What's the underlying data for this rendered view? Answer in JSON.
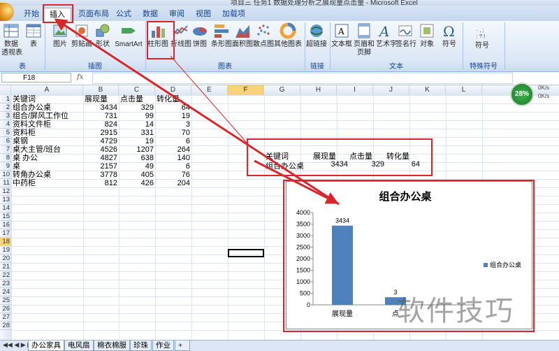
{
  "window": {
    "title": "项目三 任务1 数据处理分析之展现量点击量 - Microsoft Excel"
  },
  "tabs": [
    {
      "label": "开始"
    },
    {
      "label": "插入"
    },
    {
      "label": "页面布局"
    },
    {
      "label": "公式"
    },
    {
      "label": "数据"
    },
    {
      "label": "审阅"
    },
    {
      "label": "视图"
    },
    {
      "label": "加载项"
    }
  ],
  "ribbon": {
    "buttons": [
      {
        "label": "数据",
        "label2": "透视表",
        "icon": "pivot-table-icon"
      },
      {
        "label": "表",
        "icon": "table-icon"
      },
      {
        "label": "图片",
        "icon": "picture-icon"
      },
      {
        "label": "剪贴画",
        "icon": "clipart-icon"
      },
      {
        "label": "形状",
        "icon": "shapes-icon"
      },
      {
        "label": "SmartArt",
        "icon": "smartart-icon"
      },
      {
        "label": "柱形图",
        "icon": "column-chart-icon"
      },
      {
        "label": "折线图",
        "icon": "line-chart-icon"
      },
      {
        "label": "饼图",
        "icon": "pie-chart-icon"
      },
      {
        "label": "条形图",
        "icon": "bar-chart-icon"
      },
      {
        "label": "面积图",
        "icon": "area-chart-icon"
      },
      {
        "label": "散点图",
        "icon": "scatter-chart-icon"
      },
      {
        "label": "其他图表",
        "icon": "other-chart-icon"
      },
      {
        "label": "超链接",
        "icon": "hyperlink-icon"
      },
      {
        "label": "文本框",
        "icon": "textbox-icon"
      },
      {
        "label": "页眉和",
        "label2": "页脚",
        "icon": "header-footer-icon"
      },
      {
        "label": "艺术字",
        "icon": "wordart-icon"
      },
      {
        "label": "签名行",
        "icon": "signature-icon"
      },
      {
        "label": "对象",
        "icon": "object-icon"
      },
      {
        "label": "符号",
        "icon": "omega-icon"
      },
      {
        "label": "符号",
        "icon": "symbol-icon"
      }
    ],
    "groups": [
      "表",
      "插图",
      "图表",
      "链接",
      "文本",
      "特殊符号"
    ]
  },
  "formula_bar": {
    "name_box": "F18",
    "fx": "fx"
  },
  "columns": [
    "A",
    "B",
    "C",
    "D",
    "E",
    "F",
    "G",
    "H",
    "I",
    "J",
    "K",
    "L"
  ],
  "rows": [
    "1",
    "2",
    "3",
    "4",
    "5",
    "6",
    "7",
    "8",
    "9",
    "10",
    "11",
    "12",
    "13",
    "14",
    "15",
    "16",
    "17",
    "18",
    "19",
    "20",
    "21",
    "22",
    "23",
    "24",
    "25",
    "26",
    "27",
    "28"
  ],
  "table": {
    "headers": [
      "关键词",
      "展现量",
      "点击量",
      "转化量"
    ],
    "rows": [
      [
        "组合办公桌",
        "3434",
        "329",
        "64"
      ],
      [
        "组合/屏风工作位",
        "731",
        "99",
        "19"
      ],
      [
        "资料文件柜",
        "824",
        "14",
        "3"
      ],
      [
        "资料柜",
        "2915",
        "331",
        "70"
      ],
      [
        "桌钢",
        "4729",
        "19",
        "6"
      ],
      [
        "桌大主管/班台",
        "4526",
        "1207",
        "264"
      ],
      [
        "桌 办公",
        "4827",
        "638",
        "140"
      ],
      [
        "桌",
        "2157",
        "49",
        "6"
      ],
      [
        "转角办公桌",
        "3778",
        "405",
        "76"
      ],
      [
        "中药柜",
        "812",
        "426",
        "204"
      ]
    ]
  },
  "subtable": {
    "headers": [
      "关键词",
      "展现量",
      "点击量",
      "转化量"
    ],
    "row": [
      "组合办公桌",
      "3434",
      "329",
      "64"
    ]
  },
  "sheets": [
    "办公家具",
    "电风扇",
    "棉衣棉服",
    "珍珠",
    "作业"
  ],
  "speed": {
    "percent": "28%",
    "up": "0K/s",
    "down": "0K/s"
  },
  "watermark": "软件技巧",
  "colors": {
    "accent_red": "#d9262a",
    "bar_blue": "#4f81bd",
    "selected_header": "#f8d27d"
  },
  "chart_data": {
    "type": "bar",
    "title": "组合办公桌",
    "categories": [
      "展现量",
      "点击量"
    ],
    "category_labels_visible": [
      "展现量",
      "点"
    ],
    "series": [
      {
        "name": "组合办公桌",
        "values": [
          3434,
          329
        ]
      }
    ],
    "data_labels": [
      "3434",
      "3"
    ],
    "legend_label": "组合办公桌",
    "legend_position": "right",
    "yticks": [
      "4000",
      "3500",
      "3000",
      "2500",
      "2000",
      "1500",
      "1000",
      "500",
      "0"
    ],
    "ylim": [
      0,
      4000
    ],
    "grid": false
  }
}
